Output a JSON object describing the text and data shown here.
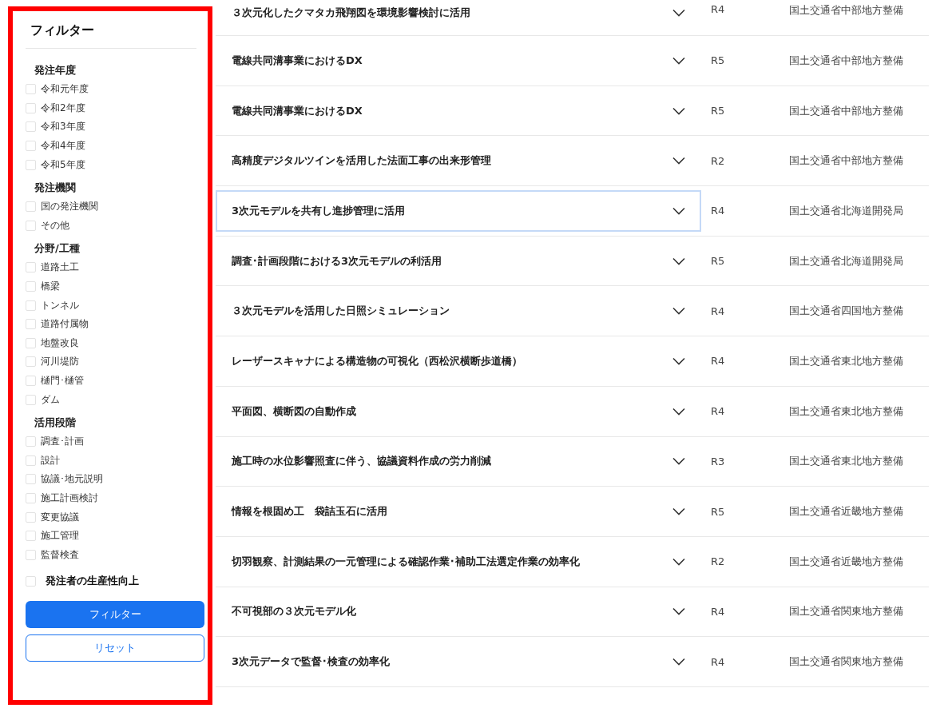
{
  "filter": {
    "title": "フィルター",
    "groups": [
      {
        "heading": "発注年度",
        "options": [
          {
            "label": "令和元年度",
            "checked": false
          },
          {
            "label": "令和2年度",
            "checked": false
          },
          {
            "label": "令和3年度",
            "checked": false
          },
          {
            "label": "令和4年度",
            "checked": false
          },
          {
            "label": "令和5年度",
            "checked": false
          }
        ]
      },
      {
        "heading": "発注機関",
        "options": [
          {
            "label": "国の発注機関",
            "checked": false
          },
          {
            "label": "その他",
            "checked": false
          }
        ]
      },
      {
        "heading": "分野/工種",
        "options": [
          {
            "label": "道路土工",
            "checked": false
          },
          {
            "label": "橋梁",
            "checked": false
          },
          {
            "label": "トンネル",
            "checked": false
          },
          {
            "label": "道路付属物",
            "checked": false
          },
          {
            "label": "地盤改良",
            "checked": false
          },
          {
            "label": "河川堤防",
            "checked": false
          },
          {
            "label": "樋門･樋管",
            "checked": false
          },
          {
            "label": "ダム",
            "checked": false
          }
        ]
      },
      {
        "heading": "活用段階",
        "options": [
          {
            "label": "調査･計画",
            "checked": false
          },
          {
            "label": "設計",
            "checked": false
          },
          {
            "label": "協議･地元説明",
            "checked": false
          },
          {
            "label": "施工計画検討",
            "checked": false
          },
          {
            "label": "変更協議",
            "checked": false
          },
          {
            "label": "施工管理",
            "checked": false
          },
          {
            "label": "監督検査",
            "checked": false
          }
        ]
      }
    ],
    "standalone": {
      "label": "発注者の生産性向上",
      "checked": false
    },
    "apply_button": "フィルター",
    "reset_button": "リセット"
  },
  "cases": [
    {
      "title": "３次元化したクマタカ飛翔図を環境影響検討に活用",
      "year": "R4",
      "agency": "国土交通省中部地方整備",
      "selected": false
    },
    {
      "title": "電線共同溝事業におけるDX",
      "year": "R5",
      "agency": "国土交通省中部地方整備",
      "selected": false
    },
    {
      "title": "電線共同溝事業におけるDX",
      "year": "R5",
      "agency": "国土交通省中部地方整備",
      "selected": false
    },
    {
      "title": "高精度デジタルツインを活用した法面工事の出来形管理",
      "year": "R2",
      "agency": "国土交通省中部地方整備",
      "selected": false
    },
    {
      "title": "3次元モデルを共有し進捗管理に活用",
      "year": "R4",
      "agency": "国土交通省北海道開発局",
      "selected": true
    },
    {
      "title": "調査･計画段階における3次元モデルの利活用",
      "year": "R5",
      "agency": "国土交通省北海道開発局",
      "selected": false
    },
    {
      "title": "３次元モデルを活用した日照シミュレーション",
      "year": "R4",
      "agency": "国土交通省四国地方整備",
      "selected": false
    },
    {
      "title": "レーザースキャナによる構造物の可視化（西松沢横断歩道橋）",
      "year": "R4",
      "agency": "国土交通省東北地方整備",
      "selected": false
    },
    {
      "title": "平面図、横断図の自動作成",
      "year": "R4",
      "agency": "国土交通省東北地方整備",
      "selected": false
    },
    {
      "title": "施工時の水位影響照査に伴う、協議資料作成の労力削減",
      "year": "R3",
      "agency": "国土交通省東北地方整備",
      "selected": false
    },
    {
      "title": "情報を根固め工　袋詰玉石に活用",
      "year": "R5",
      "agency": "国土交通省近畿地方整備",
      "selected": false
    },
    {
      "title": "切羽観察、計測結果の一元管理による確認作業･補助工法選定作業の効率化",
      "year": "R2",
      "agency": "国土交通省近畿地方整備",
      "selected": false
    },
    {
      "title": "不可視部の３次元モデル化",
      "year": "R4",
      "agency": "国土交通省関東地方整備",
      "selected": false
    },
    {
      "title": "3次元データで監督･検査の効率化",
      "year": "R4",
      "agency": "国土交通省関東地方整備",
      "selected": false
    }
  ]
}
